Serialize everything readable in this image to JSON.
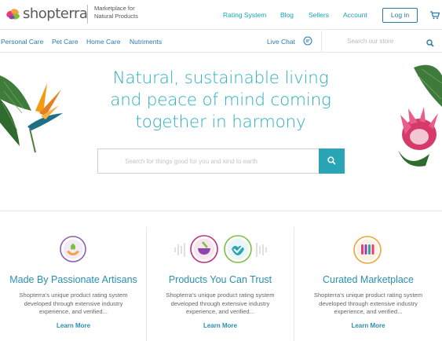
{
  "header": {
    "logo_text": "shopterra",
    "tagline_line1": "Marketplace for",
    "tagline_line2": "Natural Products",
    "nav": [
      "Rating System",
      "Blog",
      "Sellers",
      "Account"
    ],
    "login_label": "Log in"
  },
  "subnav": {
    "categories": [
      "Personal Care",
      "Pet Care",
      "Home Care",
      "Nutriments"
    ],
    "live_chat": "Live Chat",
    "search_placeholder": "Search our store"
  },
  "hero": {
    "line1": "Natural, sustainable living",
    "line2": "and peace of mind coming",
    "line3": "together in harmony",
    "search_placeholder": "Search for things good for you and kind to earth"
  },
  "features": [
    {
      "title": "Made By Passionate Artisans",
      "desc1": "Shopterra's unique product rating system",
      "desc2": "developed through extensive industry",
      "desc3": "experience, and verified...",
      "link": "Learn More"
    },
    {
      "title": "Products You Can Trust",
      "desc1": "Shopterra's unique product rating system",
      "desc2": "developed through extensive industry",
      "desc3": "experience, and verified...",
      "link": "Learn More"
    },
    {
      "title": "Curated Marketplace",
      "desc1": "Shopterra's unique product rating system",
      "desc2": "developed through extensive industry",
      "desc3": "experience, and verified...",
      "link": "Learn More"
    }
  ],
  "colors": {
    "accent": "#2cb0bd",
    "link": "#2a7aa8",
    "button": "#2aa5b5"
  },
  "icons": [
    "logo-icon",
    "chat-icon",
    "search-icon",
    "cart-icon",
    "artisan-hands-icon",
    "mortar-icon",
    "check-leaf-icon",
    "test-tubes-icon"
  ]
}
